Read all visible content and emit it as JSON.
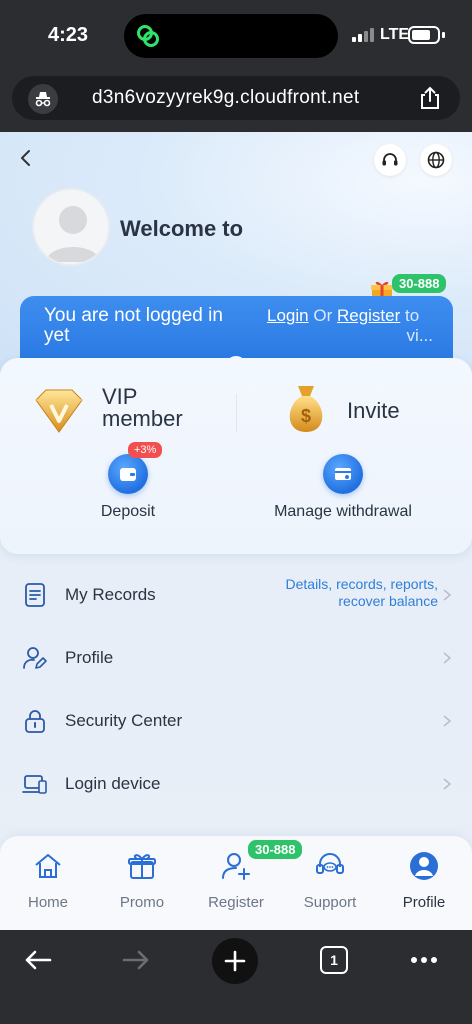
{
  "status_bar": {
    "time": "4:23",
    "network": "LTE"
  },
  "browser": {
    "url": "d3n6vozyyrek9g.cloudfront.net",
    "tab_count": "1"
  },
  "header": {
    "welcome": "Welcome to"
  },
  "promo_badge": "30-888",
  "login_banner": {
    "message": "You are not logged in yet",
    "login_link": "Login",
    "or_text": "Or",
    "register_link": "Register",
    "suffix": "to",
    "ellipsis": "vi..."
  },
  "card": {
    "vip_label": "VIP member",
    "invite_label": "Invite",
    "deposit_label": "Deposit",
    "deposit_badge": "+3%",
    "withdrawal_label": "Manage withdrawal"
  },
  "menu": [
    {
      "label": "My Records",
      "hint": "Details, records, reports, recover balance"
    },
    {
      "label": "Profile",
      "hint": ""
    },
    {
      "label": "Security Center",
      "hint": ""
    },
    {
      "label": "Login device",
      "hint": ""
    }
  ],
  "tabs": [
    {
      "label": "Home",
      "icon": "home-icon"
    },
    {
      "label": "Promo",
      "icon": "gift-icon"
    },
    {
      "label": "Register",
      "icon": "add-user-icon",
      "badge": "30-888"
    },
    {
      "label": "Support",
      "icon": "headset-icon"
    },
    {
      "label": "Profile",
      "icon": "user-icon"
    }
  ],
  "colors": {
    "accent": "#2270e0",
    "badge_green": "#2ec26b",
    "badge_red": "#f25050",
    "link": "#2f7fd8"
  }
}
